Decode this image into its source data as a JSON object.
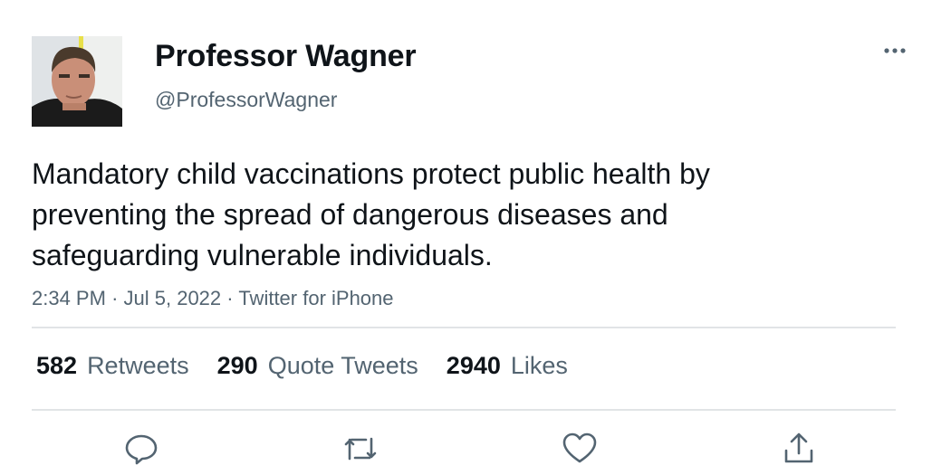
{
  "tweet": {
    "author": {
      "name": "Professor Wagner",
      "handle": "@ProfessorWagner",
      "avatar_icon": "profile-photo"
    },
    "text": "Mandatory child vaccinations protect public health by\npreventing the spread of dangerous diseases and\nsafeguarding vulnerable individuals.",
    "meta": {
      "time": "2:34 PM",
      "separator": "·",
      "date": "Jul 5, 2022",
      "source": "Twitter for iPhone"
    },
    "stats": [
      {
        "count": "582",
        "label": "Retweets"
      },
      {
        "count": "290",
        "label": "Quote Tweets"
      },
      {
        "count": "2940",
        "label": "Likes"
      }
    ],
    "actions": [
      "reply-icon",
      "retweet-icon",
      "like-icon",
      "share-icon"
    ],
    "more_icon": "more-icon"
  },
  "colors": {
    "text": "#0f1419",
    "secondary": "#536471",
    "divider": "#e1e4e6",
    "background": "#ffffff"
  }
}
